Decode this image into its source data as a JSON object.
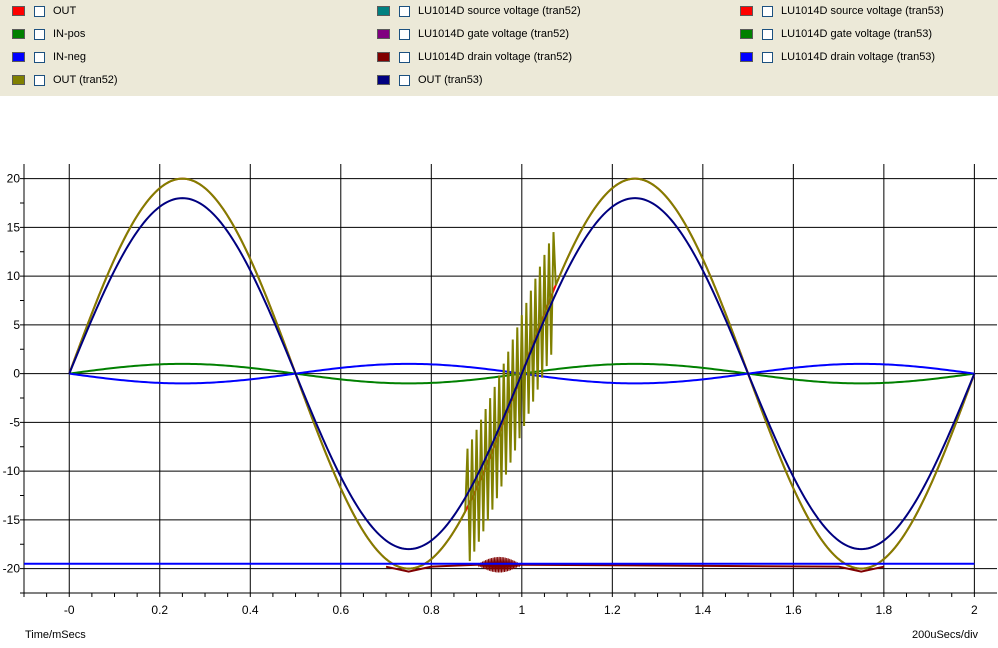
{
  "legend": {
    "items": [
      {
        "label": "OUT",
        "color": "#ff0000"
      },
      {
        "label": "IN-pos",
        "color": "#008000"
      },
      {
        "label": "IN-neg",
        "color": "#0000ff"
      },
      {
        "label": "OUT (tran52)",
        "color": "#808000"
      },
      {
        "label": "LU1014D source voltage (tran52)",
        "color": "#008080"
      },
      {
        "label": "LU1014D gate voltage (tran52)",
        "color": "#800080"
      },
      {
        "label": "LU1014D drain voltage (tran52)",
        "color": "#800000"
      },
      {
        "label": "OUT (tran53)",
        "color": "#000080"
      },
      {
        "label": "LU1014D source voltage (tran53)",
        "color": "#ff0000"
      },
      {
        "label": "LU1014D gate voltage (tran53)",
        "color": "#008000"
      },
      {
        "label": "LU1014D drain voltage (tran53)",
        "color": "#0000ff"
      }
    ]
  },
  "chart_data": {
    "type": "line",
    "xlabel": "Time/mSecs",
    "scale_label": "200uSecs/div",
    "xlim": [
      -0.1,
      2.05
    ],
    "ylim": [
      -22.5,
      21.5
    ],
    "xticks": [
      0,
      0.2,
      0.4,
      0.6,
      0.8,
      1,
      1.2,
      1.4,
      1.6,
      1.8,
      2
    ],
    "xtick_labels": [
      "-0",
      "0.2",
      "0.4",
      "0.6",
      "0.8",
      "1",
      "1.2",
      "1.4",
      "1.6",
      "1.8",
      "2"
    ],
    "yticks": [
      20,
      15,
      10,
      5,
      0,
      -5,
      -10,
      -15,
      -20
    ],
    "ytick_labels": [
      "20",
      "15",
      "10",
      "5",
      "0",
      "-5",
      "-10",
      "-15",
      "-20"
    ],
    "grid": true,
    "series": [
      {
        "name": "OUT",
        "color": "#ff0000",
        "x": [
          0,
          0.1,
          0.2,
          0.25,
          0.3,
          0.4,
          0.5,
          0.6,
          0.7,
          0.75,
          0.8,
          0.9,
          1.0,
          1.1,
          1.2,
          1.25,
          1.3,
          1.4,
          1.5,
          1.6,
          1.7,
          1.75,
          1.8,
          1.9,
          2.0
        ],
        "y": [
          0,
          11.8,
          19.1,
          20,
          19.1,
          11.8,
          0,
          -11.8,
          -19.1,
          -20,
          -19.1,
          -11.8,
          0,
          11.8,
          19.1,
          20,
          19.1,
          11.8,
          0,
          -11.8,
          -19.1,
          -20,
          -19.1,
          -11.8,
          0
        ]
      },
      {
        "name": "IN-pos",
        "color": "#008000",
        "x": [
          0,
          0.25,
          0.5,
          0.75,
          1.0,
          1.25,
          1.5,
          1.75,
          2.0
        ],
        "y": [
          0,
          1,
          0,
          -1,
          0,
          1,
          0,
          -1,
          0
        ]
      },
      {
        "name": "IN-neg",
        "color": "#0000ff",
        "x": [
          0,
          0.25,
          0.5,
          0.75,
          1.0,
          1.25,
          1.5,
          1.75,
          2.0
        ],
        "y": [
          0,
          -1,
          0,
          1,
          0,
          -1,
          0,
          1,
          0
        ]
      },
      {
        "name": "OUT (tran52)",
        "color": "#808000",
        "x": [
          0,
          0.1,
          0.2,
          0.25,
          0.3,
          0.4,
          0.5,
          0.6,
          0.7,
          0.75,
          0.8,
          0.85,
          0.9,
          0.95,
          1.0,
          1.05,
          1.1,
          1.2,
          1.25,
          1.3,
          1.4,
          1.5,
          1.6,
          1.7,
          1.75,
          1.8,
          1.9,
          2.0
        ],
        "y": [
          0,
          11.8,
          19.1,
          20,
          19.1,
          11.8,
          0,
          -11.8,
          -19.1,
          -20,
          -19.1,
          -14,
          -16,
          -9,
          -3,
          6,
          11.8,
          19.1,
          20,
          19.1,
          11.8,
          0,
          -11.8,
          -19.1,
          -20,
          -19.1,
          -11.8,
          0
        ],
        "oscillation": {
          "from": 0.88,
          "to": 1.07,
          "amplitude": 6
        }
      },
      {
        "name": "LU1014D drain voltage (tran52)",
        "color": "#800000",
        "x": [
          0.7,
          0.75,
          0.8,
          0.9,
          0.95,
          1.0,
          1.7,
          1.75,
          1.8
        ],
        "y": [
          -19.8,
          -20.3,
          -19.8,
          -19.6,
          -19.5,
          -19.6,
          -19.8,
          -20.3,
          -19.8
        ],
        "oscillation": {
          "from": 0.9,
          "to": 1.0,
          "amplitude": 0.8
        }
      },
      {
        "name": "OUT (tran53)",
        "color": "#000080",
        "x": [
          0,
          0.1,
          0.2,
          0.25,
          0.3,
          0.4,
          0.5,
          0.6,
          0.7,
          0.75,
          0.8,
          0.9,
          1.0,
          1.1,
          1.2,
          1.25,
          1.3,
          1.4,
          1.5,
          1.6,
          1.7,
          1.75,
          1.8,
          1.9,
          2.0
        ],
        "y": [
          0,
          10.6,
          17.1,
          18,
          17.1,
          10.6,
          0,
          -10.6,
          -17.1,
          -18,
          -17.1,
          -10.6,
          0,
          10.6,
          17.1,
          18,
          17.1,
          10.6,
          0,
          -10.6,
          -17.1,
          -18,
          -17.1,
          -10.6,
          0
        ]
      },
      {
        "name": "LU1014D drain voltage (tran53)",
        "color": "#0000ff",
        "x": [
          -0.1,
          2.0
        ],
        "y": [
          -19.5,
          -19.5
        ]
      }
    ]
  }
}
